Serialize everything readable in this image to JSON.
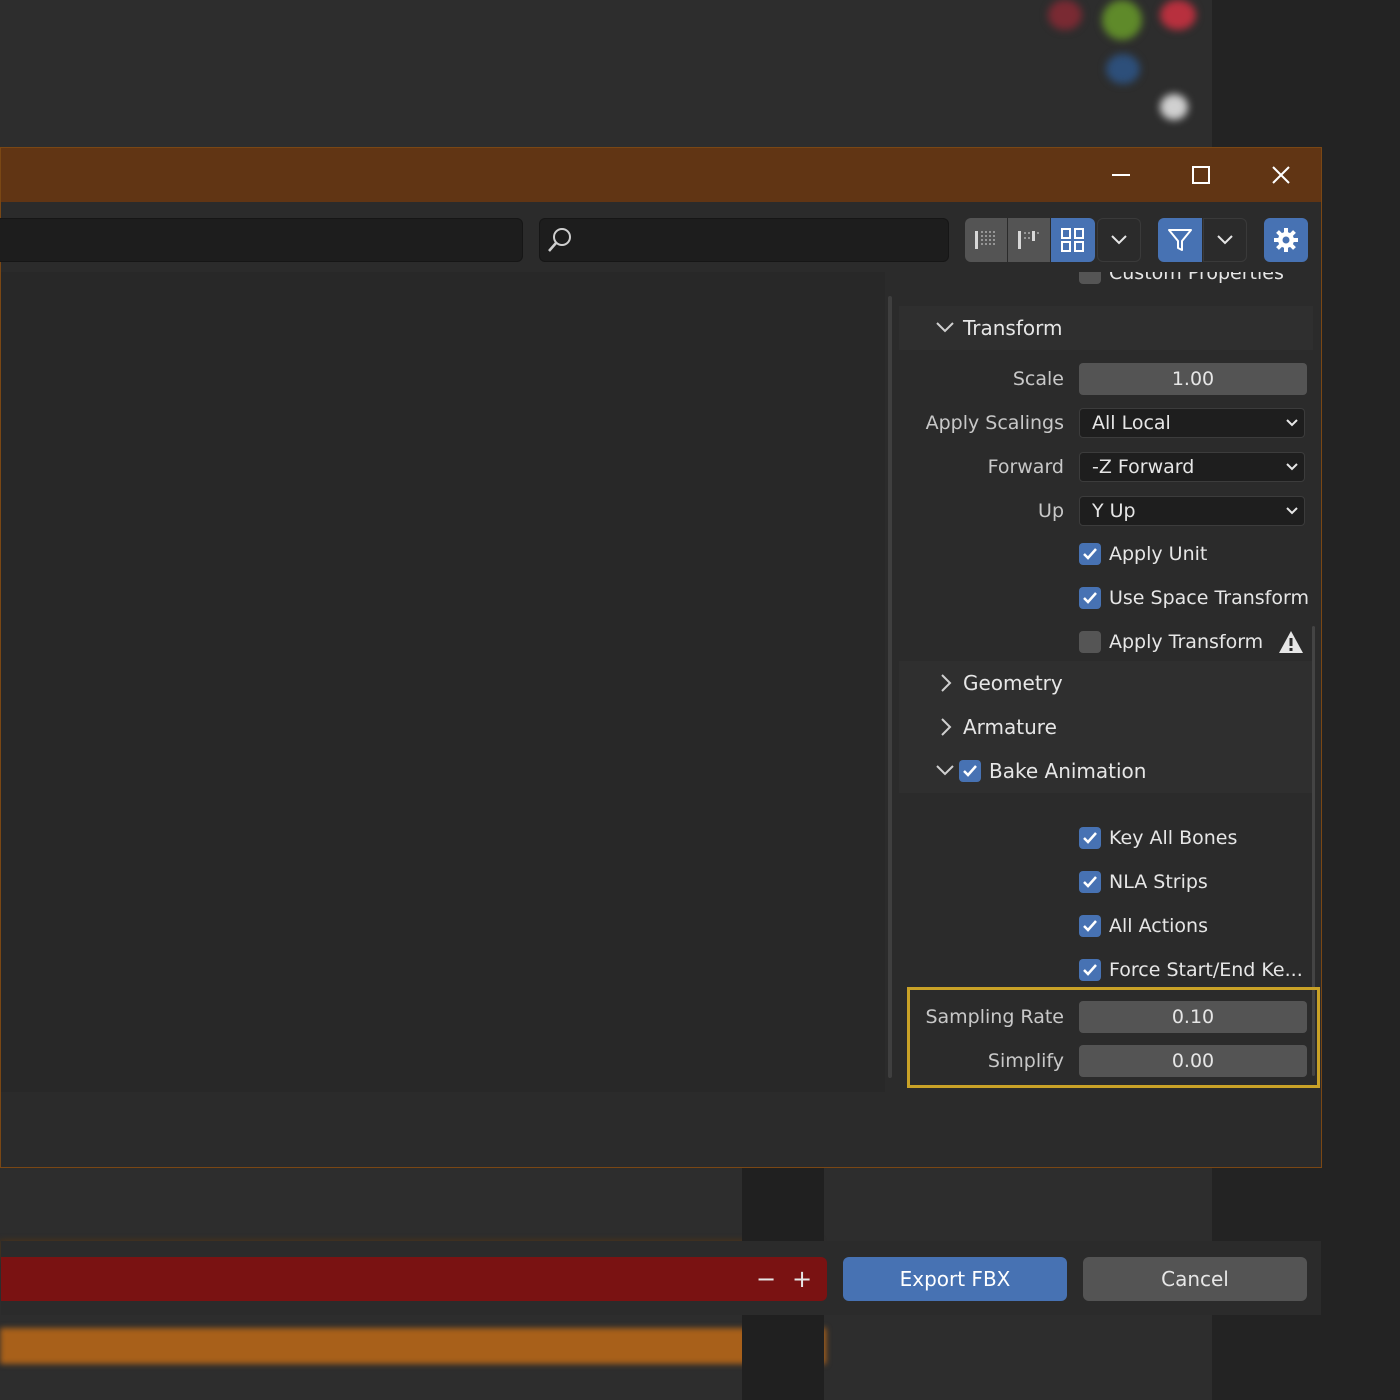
{
  "window": {
    "minimize_icon": "minimize-icon",
    "maximize_icon": "maximize-icon",
    "close_icon": "close-icon"
  },
  "toolbar": {
    "search_placeholder": "",
    "view_modes": [
      "vertical-list-icon",
      "horizontal-list-icon",
      "thumbnails-icon"
    ],
    "active_view": "thumbnails-icon",
    "filter_active": true,
    "settings_active": true
  },
  "panel": {
    "clipped_top_label": "Custom Properties",
    "transform": {
      "title": "Transform",
      "expanded": true,
      "scale_label": "Scale",
      "scale_value": "1.00",
      "apply_scalings_label": "Apply Scalings",
      "apply_scalings_value": "All Local",
      "forward_label": "Forward",
      "forward_value": "-Z Forward",
      "up_label": "Up",
      "up_value": "Y Up",
      "apply_unit_label": "Apply Unit",
      "apply_unit_checked": true,
      "use_space_transform_label": "Use Space Transform",
      "use_space_transform_checked": true,
      "apply_transform_label": "Apply Transform",
      "apply_transform_checked": false
    },
    "geometry": {
      "title": "Geometry",
      "expanded": false
    },
    "armature": {
      "title": "Armature",
      "expanded": false
    },
    "bake_animation": {
      "title": "Bake Animation",
      "checked": true,
      "expanded": true,
      "key_all_bones_label": "Key All Bones",
      "nla_strips_label": "NLA Strips",
      "all_actions_label": "All Actions",
      "force_start_end_label": "Force Start/End Ke...",
      "sampling_rate_label": "Sampling Rate",
      "sampling_rate_value": "0.10",
      "simplify_label": "Simplify",
      "simplify_value": "0.00"
    }
  },
  "bottom": {
    "minus_label": "−",
    "plus_label": "+",
    "export_label": "Export FBX",
    "cancel_label": "Cancel"
  },
  "colors": {
    "titlebar": "#613514",
    "accent_blue": "#4772b3",
    "error_red": "#7a1212",
    "highlight_yellow": "#c9a227"
  }
}
